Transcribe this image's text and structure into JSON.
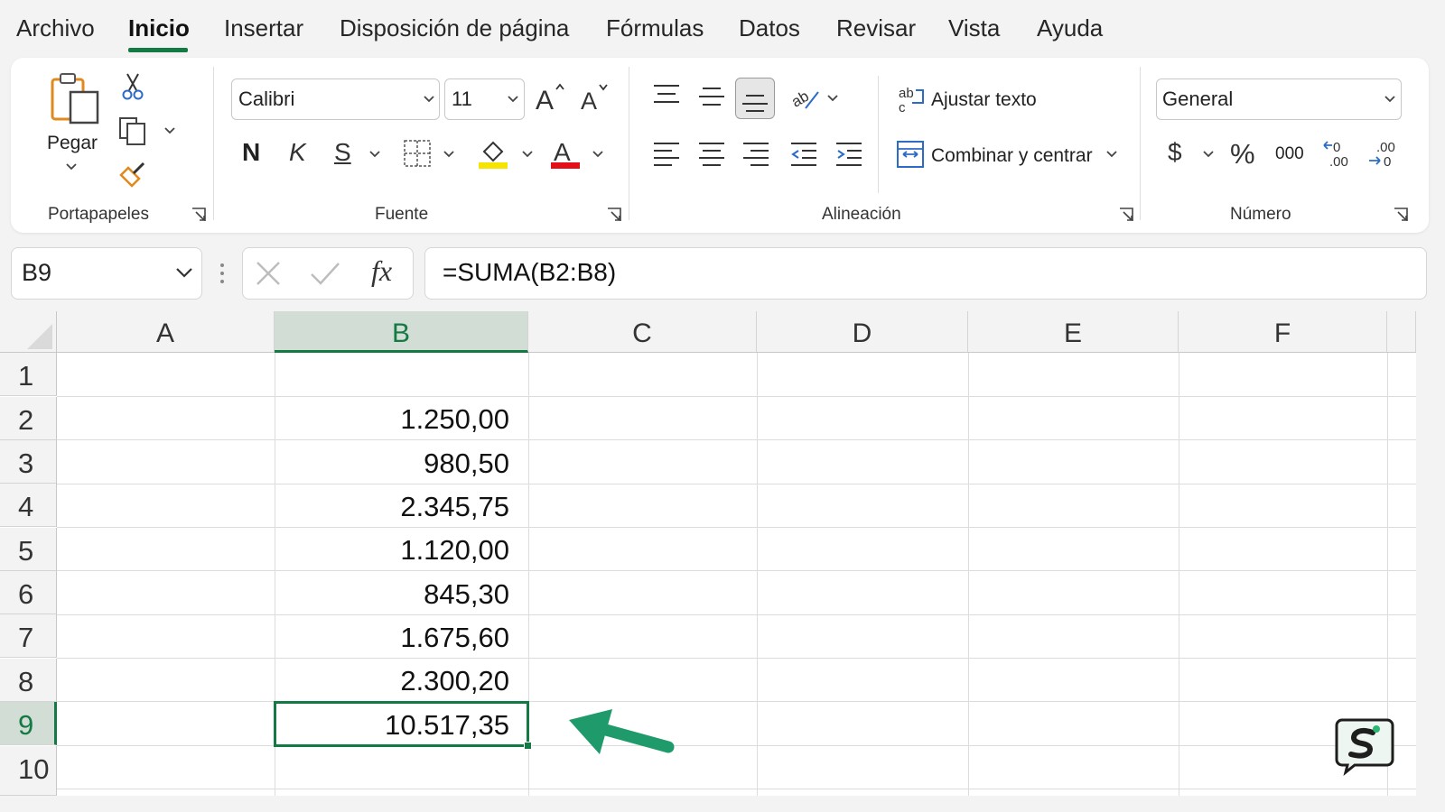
{
  "tabs": [
    {
      "label": "Archivo"
    },
    {
      "label": "Inicio"
    },
    {
      "label": "Insertar"
    },
    {
      "label": "Disposición de página"
    },
    {
      "label": "Fórmulas"
    },
    {
      "label": "Datos"
    },
    {
      "label": "Revisar"
    },
    {
      "label": "Vista"
    },
    {
      "label": "Ayuda"
    }
  ],
  "active_tab": "Inicio",
  "ribbon": {
    "clipboard": {
      "paste_label": "Pegar",
      "group_label": "Portapapeles"
    },
    "font": {
      "font_name": "Calibri",
      "font_size": "11",
      "bold": "N",
      "italic": "K",
      "underline": "S",
      "group_label": "Fuente",
      "highlight_color": "#f5e300",
      "font_color": "#e3101a"
    },
    "alignment": {
      "wrap_text": "Ajustar texto",
      "merge_center": "Combinar y centrar",
      "group_label": "Alineación"
    },
    "number": {
      "format": "General",
      "currency": "$",
      "percent": "%",
      "thousands": "000",
      "group_label": "Número"
    }
  },
  "formula_bar": {
    "name_box": "B9",
    "fx_label": "fx",
    "formula": "=SUMA(B2:B8)"
  },
  "sheet": {
    "columns": [
      "A",
      "B",
      "C",
      "D",
      "E",
      "F"
    ],
    "rows": [
      "1",
      "2",
      "3",
      "4",
      "5",
      "6",
      "7",
      "8",
      "9",
      "10"
    ],
    "column_b_values": [
      "",
      "1.250,00",
      "980,50",
      "2.345,75",
      "1.120,00",
      "845,30",
      "1.675,60",
      "2.300,20",
      "10.517,35",
      ""
    ],
    "selected_cell": "B9",
    "accent_color": "#137a43",
    "arrow_color": "#1f9a6b"
  }
}
